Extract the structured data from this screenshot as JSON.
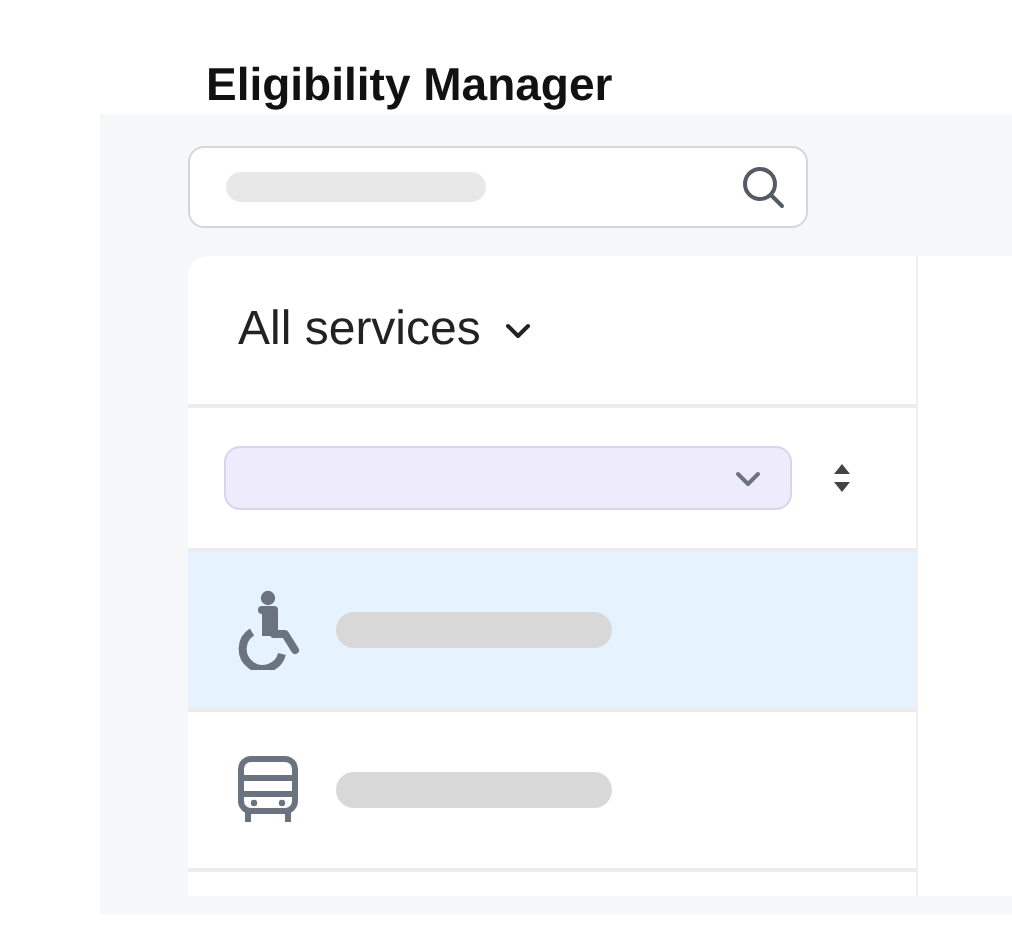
{
  "title": "Eligibility Manager",
  "filter": {
    "label": "All services"
  },
  "rows": [
    {
      "kind": "wheelchair",
      "selected": true
    },
    {
      "kind": "bus",
      "selected": false
    }
  ]
}
